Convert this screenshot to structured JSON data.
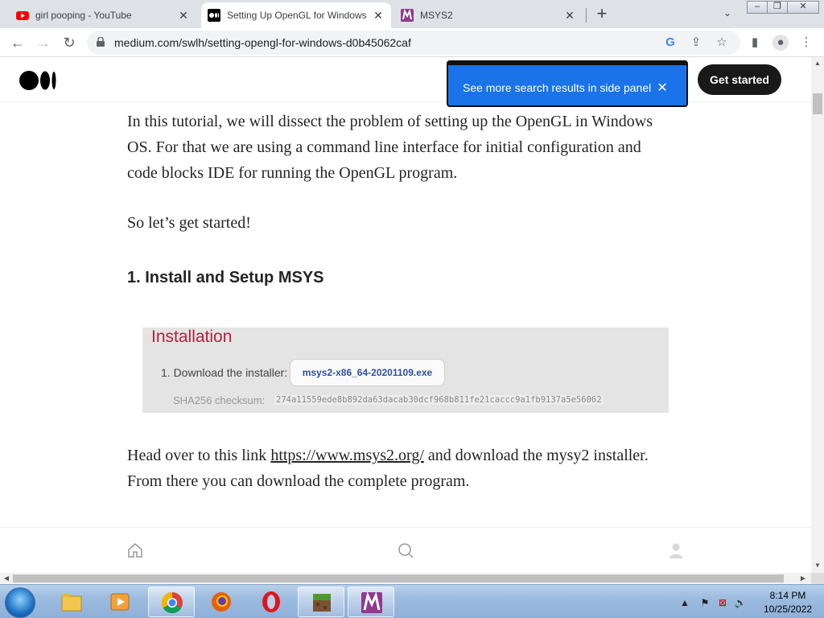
{
  "browser": {
    "tabs": [
      {
        "title": "girl pooping - YouTube",
        "favicon": "youtube-icon",
        "active": false
      },
      {
        "title": "Setting Up OpenGL for Windows",
        "favicon": "medium-icon",
        "active": true
      },
      {
        "title": "MSYS2",
        "favicon": "msys2-icon",
        "active": false
      }
    ],
    "url": "medium.com/swlh/setting-opengl-for-windows-d0b45062caf"
  },
  "header": {
    "get_started": "Get started"
  },
  "side_panel_tip": {
    "text": "See more search results in side panel"
  },
  "article": {
    "intro": "In this tutorial, we will dissect the problem of setting up the OpenGL in Windows OS. For that we are using a command line interface for initial configuration and code blocks IDE for running the OpenGL program.",
    "lets_go": "So let’s get started!",
    "heading1": "1. Install and Setup MSYS",
    "install_image": {
      "title": "Installation",
      "step": "1. Download the installer:",
      "installer_file": "msys2-x86_64-20201109.exe",
      "sha_label": "SHA256 checksum:",
      "sha_value": "274a11559ede8b892da63dacab30dcf968b811fe21caccc9a1fb9137a5e56062"
    },
    "para3_before": "Head over to this link ",
    "para3_link": "https://www.msys2.org/",
    "para3_after": " and download the mysy2 installer. From there you can download the complete program."
  },
  "taskbar": {
    "time": "8:14 PM",
    "date": "10/25/2022",
    "apps": [
      "file-explorer-icon",
      "media-player-icon",
      "chrome-icon",
      "firefox-icon",
      "opera-icon",
      "minecraft-icon",
      "msys2-icon"
    ]
  },
  "colors": {
    "tip_blue": "#1a73e8",
    "install_title_red": "#b1233a",
    "button_dark": "#191919"
  }
}
